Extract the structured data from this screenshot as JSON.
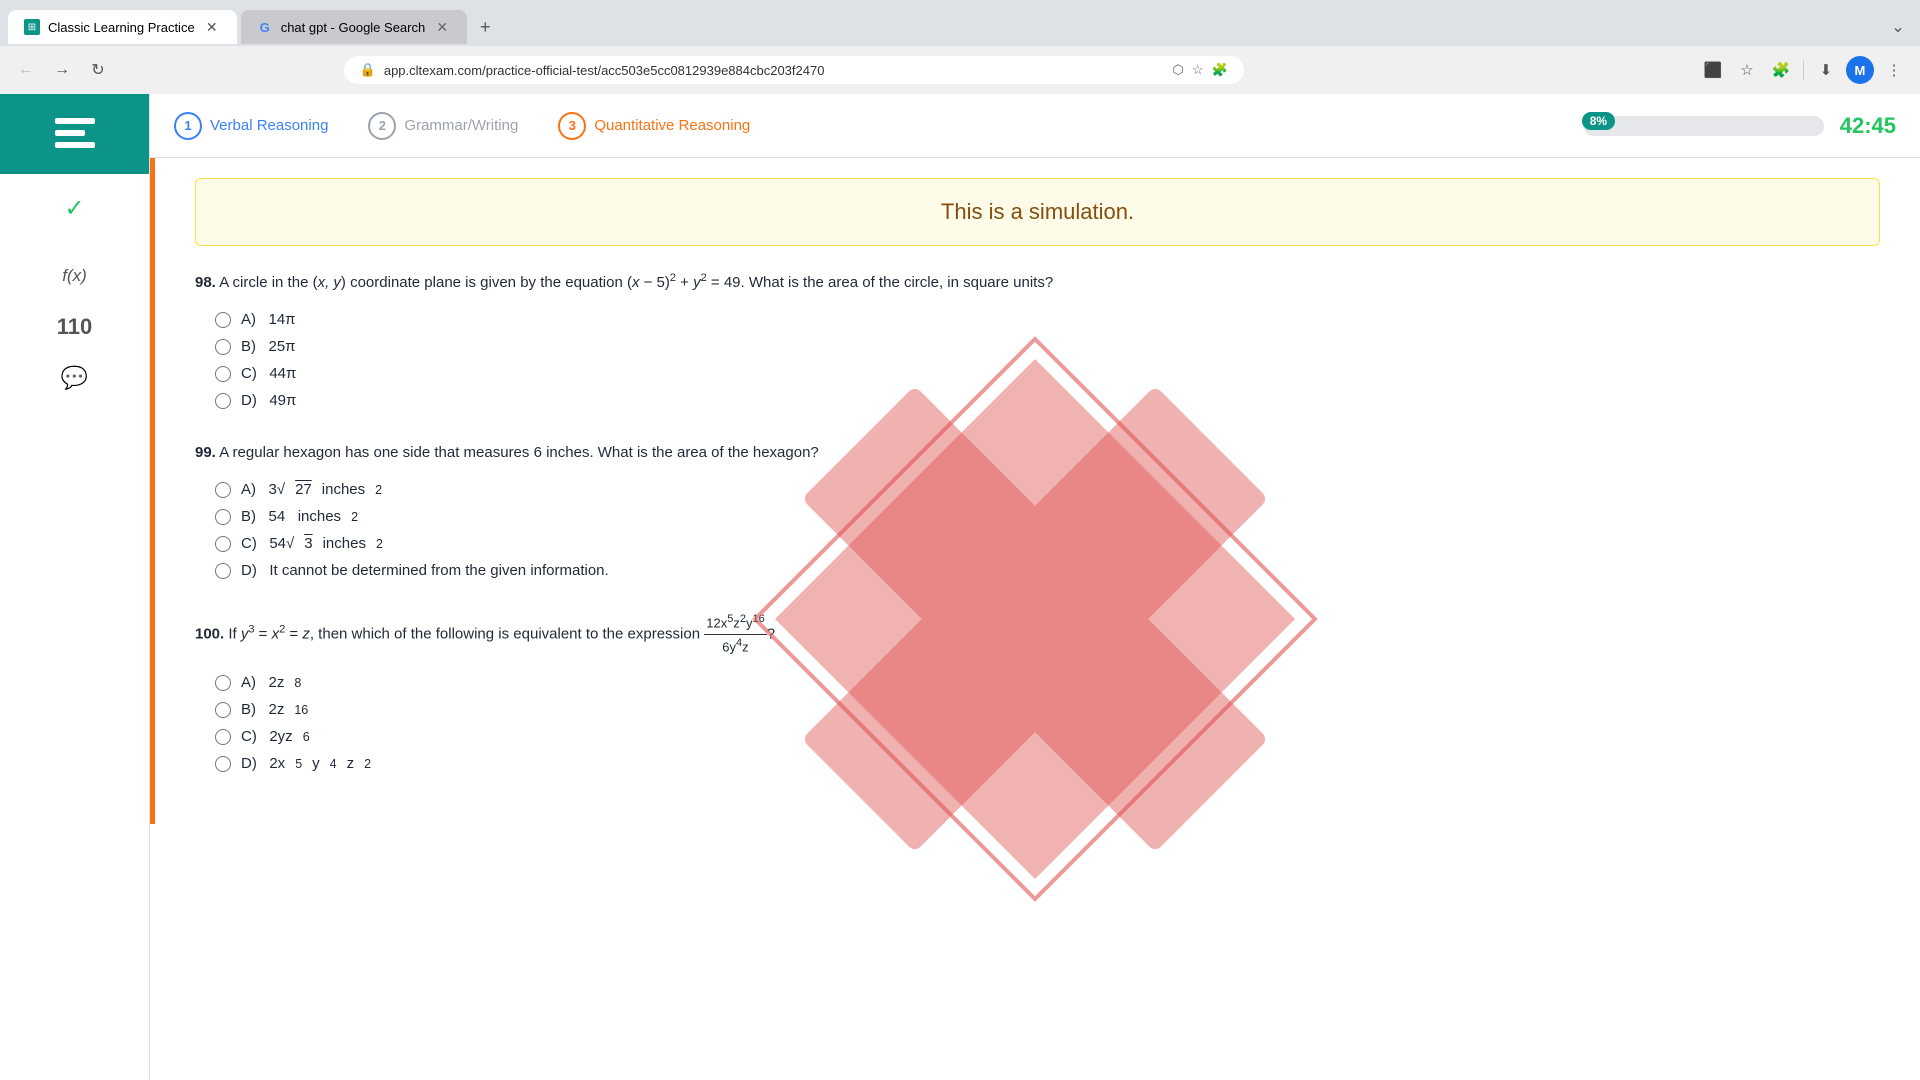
{
  "browser": {
    "tabs": [
      {
        "id": "tab1",
        "favicon_type": "teal",
        "favicon_text": "≡",
        "label": "Classic Learning Practice",
        "active": true
      },
      {
        "id": "tab2",
        "favicon_type": "google",
        "favicon_text": "G",
        "label": "chat gpt - Google Search",
        "active": false
      }
    ],
    "url": "app.cltexam.com/practice-official-test/acc503e5cc0812939e884cbc203f2470",
    "profile_letter": "M"
  },
  "app": {
    "logo_alt": "CLE Logo",
    "sidebar": {
      "check_icon": "✓",
      "fx_label": "f(x)",
      "question_number": "110",
      "chat_icon": "💬"
    },
    "top_nav": {
      "steps": [
        {
          "number": "1",
          "label": "Verbal Reasoning",
          "color": "blue"
        },
        {
          "number": "2",
          "label": "Grammar/Writing",
          "color": "gray"
        },
        {
          "number": "3",
          "label": "Quantitative Reasoning",
          "color": "orange"
        }
      ],
      "progress_percent": "8%",
      "timer": "42:45"
    },
    "simulation_banner": {
      "text": "This is a simulation."
    },
    "questions": [
      {
        "number": "98",
        "text": "A circle in the (x, y) coordinate plane is given by the equation (x − 5)² + y² = 49. What is the area of the circle, in square units?",
        "options": [
          {
            "label": "A)",
            "value": "14π"
          },
          {
            "label": "B)",
            "value": "25π"
          },
          {
            "label": "C)",
            "value": "44π"
          },
          {
            "label": "D)",
            "value": "49π"
          }
        ]
      },
      {
        "number": "99",
        "text": "A regular hexagon has one side that measures 6 inches. What is the area of the hexagon?",
        "options": [
          {
            "label": "A)",
            "value": "3√27 inches²"
          },
          {
            "label": "B)",
            "value": "54  inches²"
          },
          {
            "label": "C)",
            "value": "54√3 inches²"
          },
          {
            "label": "D)",
            "value": "It cannot be determined from the given information."
          }
        ]
      },
      {
        "number": "100",
        "text": "If y³ = x² = z, then which of the following is equivalent to the expression 12x⁵z²y¹⁶ / 6y⁴z ?",
        "options": [
          {
            "label": "A)",
            "value": "2z⁸"
          },
          {
            "label": "B)",
            "value": "2z¹⁶"
          },
          {
            "label": "C)",
            "value": "2yz⁶"
          },
          {
            "label": "D)",
            "value": "2x⁵y⁴z²"
          }
        ]
      }
    ]
  }
}
